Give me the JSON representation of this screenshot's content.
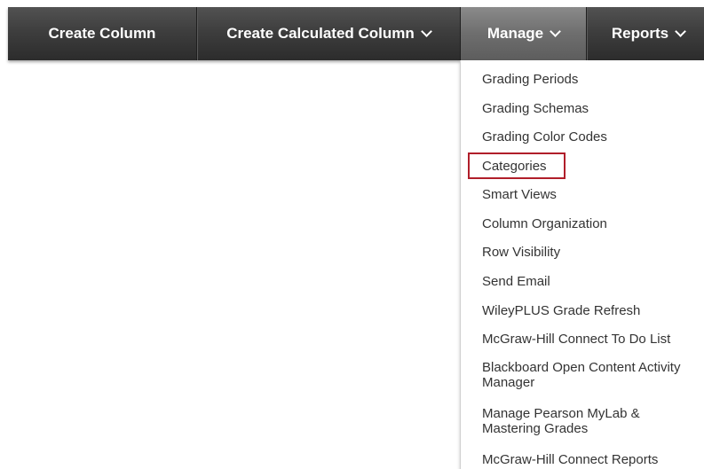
{
  "toolbar": {
    "create_column": "Create Column",
    "create_calculated_column": "Create Calculated Column",
    "manage": "Manage",
    "reports": "Reports"
  },
  "manage_menu": {
    "items": [
      "Grading Periods",
      "Grading Schemas",
      "Grading Color Codes",
      "Categories",
      "Smart Views",
      "Column Organization",
      "Row Visibility",
      "Send Email",
      "WileyPLUS Grade Refresh",
      "McGraw-Hill Connect To Do List",
      "Blackboard Open Content Activity Manager",
      "Manage Pearson MyLab & Mastering Grades",
      "McGraw-Hill Connect Reports"
    ],
    "highlighted_item": "Categories"
  },
  "colors": {
    "toolbar_bg": "#3e3e3e",
    "active_tab_bg": "#6e6e6e",
    "menu_text": "#333333",
    "highlight_border": "#b01e2a"
  }
}
